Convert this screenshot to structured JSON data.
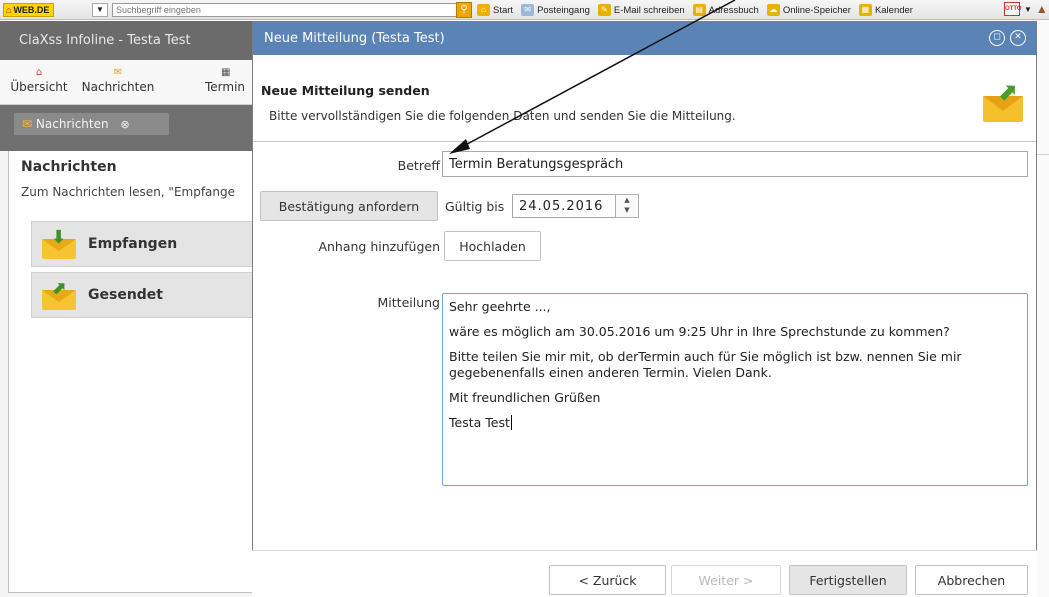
{
  "browser_toolbar": {
    "logo": "WEB.DE",
    "search_placeholder": "Suchbegriff eingeben",
    "links": [
      {
        "label": "Start",
        "icon": "home-icon"
      },
      {
        "label": "Posteingang",
        "icon": "inbox-icon"
      },
      {
        "label": "E-Mail schreiben",
        "icon": "compose-icon"
      },
      {
        "label": "Adressbuch",
        "icon": "addressbook-icon"
      },
      {
        "label": "Online-Speicher",
        "icon": "cloud-storage-icon"
      },
      {
        "label": "Kalender",
        "icon": "calendar-icon"
      }
    ],
    "otto_label": "OTTO"
  },
  "app": {
    "title": "ClaXss Infoline - Testa Test",
    "nav": [
      {
        "label": "Übersicht",
        "icon": "home-icon"
      },
      {
        "label": "Nachrichten",
        "icon": "mail-icon"
      },
      {
        "label": "Termin",
        "icon": "calendar-icon"
      }
    ],
    "tab_label": "Nachrichten",
    "section_title": "Nachrichten",
    "section_hint": "Zum Nachrichten lesen, \"Empfange",
    "buttons": [
      {
        "label": "Empfangen",
        "icon": "envelope-receive-icon"
      },
      {
        "label": "Gesendet",
        "icon": "envelope-send-icon"
      }
    ]
  },
  "dialog": {
    "title": "Neue Mitteilung (Testa Test)",
    "header_title": "Neue Mitteilung senden",
    "header_subtitle": "Bitte vervollständigen Sie die folgenden Daten und senden Sie die Mitteilung.",
    "subject_label": "Betreff",
    "subject_value": "Termin Beratungsgespräch",
    "confirm_button": "Bestätigung anfordern",
    "valid_until_label": "Gültig bis",
    "valid_until_value": "24.05.2016",
    "attachment_label": "Anhang hinzufügen",
    "upload_button": "Hochladen",
    "message_label": "Mitteilung",
    "message_lines": [
      "Sehr geehrte ...,",
      "wäre es möglich am 30.05.2016 um 9:25 Uhr in Ihre Sprechstunde zu kommen?",
      "Bitte teilen Sie mir mit, ob derTermin auch für Sie möglich ist bzw. nennen Sie mir gegebenenfalls einen anderen Termin. Vielen Dank.",
      "Mit freundlichen Grüßen",
      "Testa Test"
    ],
    "footer_buttons": {
      "back": "< Zurück",
      "next": "Weiter >",
      "finish": "Fertigstellen",
      "cancel": "Abbrechen"
    }
  },
  "colors": {
    "dialog_titlebar": "#5a83b6",
    "app_titlebar": "#6b6b6b",
    "textarea_focus_border": "#7b9fd0"
  }
}
